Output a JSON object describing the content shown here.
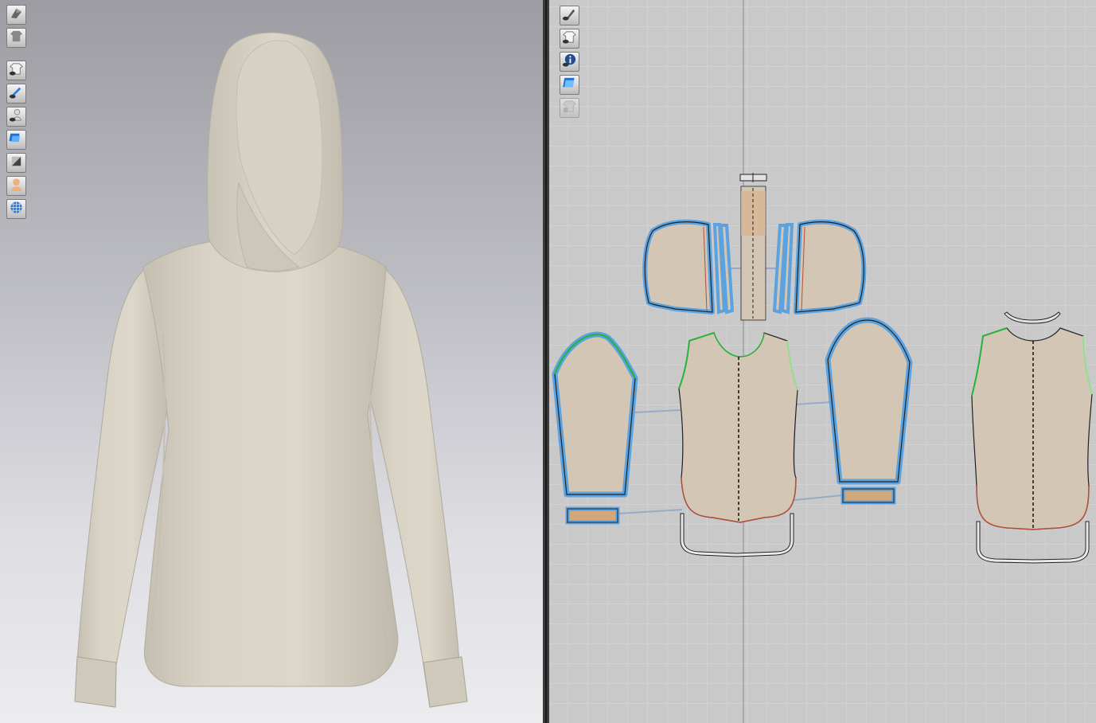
{
  "window": {
    "title": ""
  },
  "viewport3d": {
    "toolbar": [
      {
        "icon": "render-style-icon"
      },
      {
        "icon": "garment-display-icon"
      },
      {
        "icon": "show-garment-icon"
      },
      {
        "icon": "show-pins-icon"
      },
      {
        "icon": "show-avatar-icon"
      },
      {
        "icon": "texture-view-icon"
      },
      {
        "icon": "fabric-shading-icon"
      },
      {
        "icon": "avatar-display-icon"
      },
      {
        "icon": "mesh-grid-icon"
      }
    ],
    "background_top": "#9c9ca2",
    "background_bottom": "#ececef",
    "garment_color": "#d6d0c3"
  },
  "viewport2d": {
    "toolbar": [
      {
        "icon": "show-2d-pattern-icon"
      },
      {
        "icon": "show-garment-2d-icon"
      },
      {
        "icon": "pattern-info-icon"
      },
      {
        "icon": "show-texture-2d-icon"
      },
      {
        "icon": "lock-pattern-icon",
        "disabled": true
      }
    ],
    "grid_color": "#d2d2d2",
    "pattern_fill": "#d4c6b4",
    "selection_outline": "#5aa2e0",
    "seam_green": "#27b33a",
    "pieces": [
      "hood-left",
      "hood-right",
      "hood-center-strip",
      "sleeve-left",
      "sleeve-right",
      "front-body",
      "back-body",
      "cuff-left",
      "cuff-right",
      "front-hem-band",
      "back-hem-band",
      "back-neck-band",
      "neck-band-top"
    ]
  }
}
